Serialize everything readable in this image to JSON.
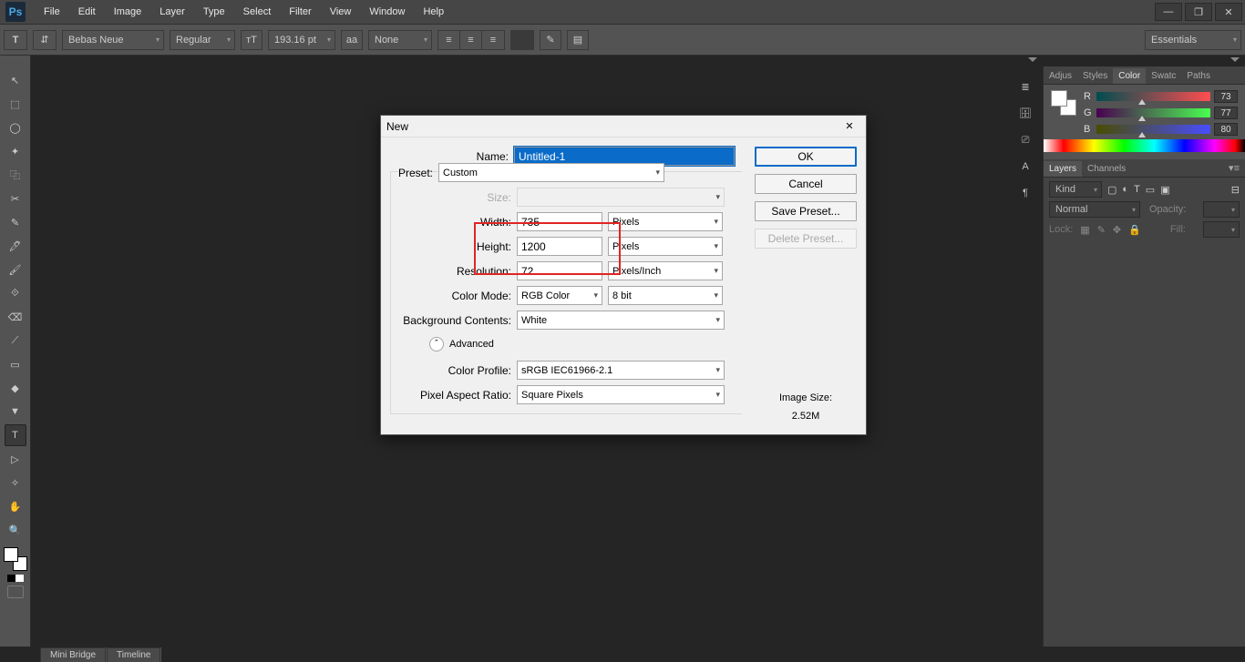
{
  "menubar": {
    "items": [
      "File",
      "Edit",
      "Image",
      "Layer",
      "Type",
      "Select",
      "Filter",
      "View",
      "Window",
      "Help"
    ]
  },
  "window_controls": {
    "minimize": "—",
    "restore": "❐",
    "close": "✕"
  },
  "optionsbar": {
    "font_family": "Bebas Neue",
    "font_style": "Regular",
    "font_size": "193.16 pt",
    "aa": "aa",
    "anti_alias": "None",
    "workspace": "Essentials"
  },
  "toolbox": {
    "tools": [
      "↖",
      "⬚",
      "◯",
      "✦",
      "⿻",
      "✂",
      "✎",
      "🖊",
      "🖌",
      "⟐",
      "⌫",
      "⟋",
      "▭",
      "◆",
      "▼",
      "◐",
      "🔍",
      "✒",
      "T",
      "▷",
      "✧",
      "✋",
      "🔍"
    ],
    "active_index": 18
  },
  "rightstrip": {
    "items": [
      "≣",
      "🗄",
      "⎚",
      "A",
      "¶"
    ]
  },
  "panels": {
    "group1_tabs": [
      "Adjus",
      "Styles",
      "Color",
      "Swatc",
      "Paths"
    ],
    "group1_active": 2,
    "color": {
      "r": 73,
      "g": 77,
      "b": 80
    },
    "group2_tabs": [
      "Layers",
      "Channels"
    ],
    "group2_active": 0,
    "layers": {
      "kind": "Kind",
      "blend_mode": "Normal",
      "opacity_label": "Opacity:",
      "lock_label": "Lock:",
      "fill_label": "Fill:"
    }
  },
  "bottom_tabs": [
    "Mini Bridge",
    "Timeline"
  ],
  "dialog": {
    "title": "New",
    "labels": {
      "name": "Name:",
      "preset": "Preset:",
      "size": "Size:",
      "width": "Width:",
      "height": "Height:",
      "resolution": "Resolution:",
      "color_mode": "Color Mode:",
      "bg_contents": "Background Contents:",
      "advanced": "Advanced",
      "color_profile": "Color Profile:",
      "pixel_aspect": "Pixel Aspect Ratio:",
      "image_size": "Image Size:"
    },
    "values": {
      "name": "Untitled-1",
      "preset": "Custom",
      "size": "",
      "width": "735",
      "height": "1200",
      "resolution": "72",
      "width_unit": "Pixels",
      "height_unit": "Pixels",
      "resolution_unit": "Pixels/Inch",
      "color_mode": "RGB Color",
      "color_depth": "8 bit",
      "bg_contents": "White",
      "color_profile": "sRGB IEC61966-2.1",
      "pixel_aspect": "Square Pixels",
      "image_size": "2.52M"
    },
    "buttons": {
      "ok": "OK",
      "cancel": "Cancel",
      "save_preset": "Save Preset...",
      "delete_preset": "Delete Preset..."
    }
  }
}
